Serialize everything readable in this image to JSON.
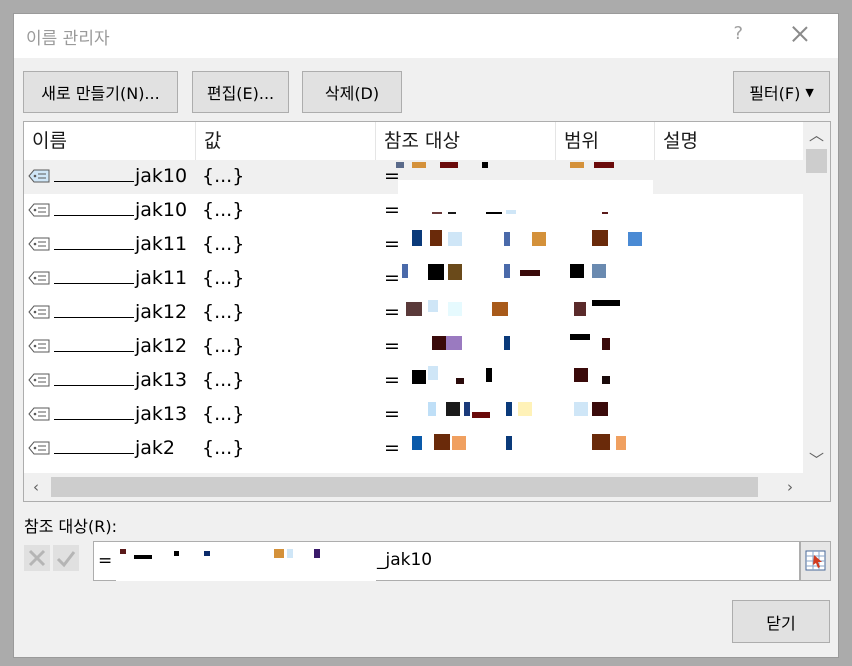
{
  "window": {
    "title": "이름 관리자",
    "help_label": "?"
  },
  "toolbar": {
    "new_label": "새로 만들기(N)...",
    "edit_label": "편집(E)...",
    "delete_label": "삭제(D)",
    "filter_label": "필터(F)"
  },
  "columns": {
    "name": "이름",
    "value": "값",
    "refers_to": "참조 대상",
    "scope": "범위",
    "comment": "설명"
  },
  "rows": [
    {
      "name": "jak10",
      "value": "{...}",
      "ref_prefix": "="
    },
    {
      "name": "jak10",
      "value": "{...}",
      "ref_prefix": "="
    },
    {
      "name": "jak11",
      "value": "{...}",
      "ref_prefix": "="
    },
    {
      "name": "jak11",
      "value": "{...}",
      "ref_prefix": "="
    },
    {
      "name": "jak12",
      "value": "{...}",
      "ref_prefix": "="
    },
    {
      "name": "jak12",
      "value": "{...}",
      "ref_prefix": "="
    },
    {
      "name": "jak13",
      "value": "{...}",
      "ref_prefix": "="
    },
    {
      "name": "jak13",
      "value": "{...}",
      "ref_prefix": "="
    },
    {
      "name": "jak2",
      "value": "{...}",
      "ref_prefix": "="
    }
  ],
  "selected_row": 0,
  "refers_to": {
    "label": "참조 대상(R):",
    "prefix": "=",
    "suffix": "_jak10"
  },
  "footer": {
    "close_label": "닫기"
  },
  "colors": {
    "dialog_bg": "#f0f0f0",
    "backdrop": "#ababab",
    "button_bg": "#e1e1e1",
    "selection": "#f0f0f0",
    "tag_icon_selected": "#cfe6f7"
  }
}
